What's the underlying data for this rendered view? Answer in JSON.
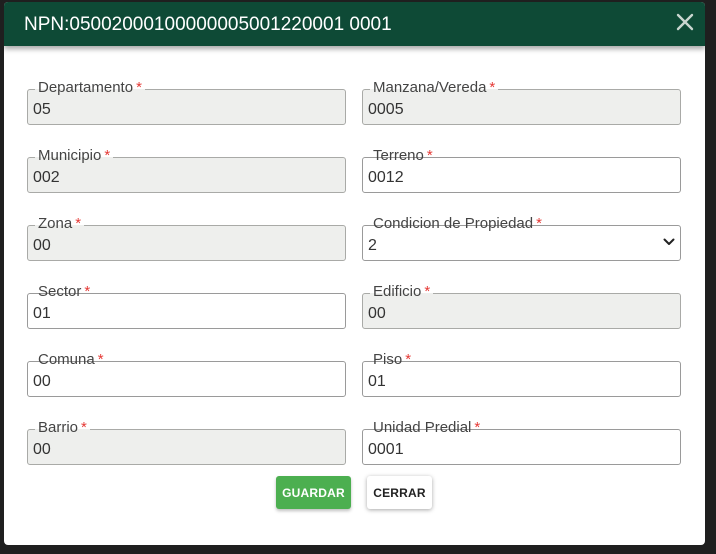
{
  "modal": {
    "title": "NPN: 05002000100000005001220001 0001",
    "close_symbol": "✕"
  },
  "fields": {
    "departamento": {
      "label": "Departamento",
      "value": "05",
      "disabled": true
    },
    "manzana": {
      "label": "Manzana/Vereda",
      "value": "0005",
      "disabled": true
    },
    "municipio": {
      "label": "Municipio",
      "value": "002",
      "disabled": true
    },
    "terreno": {
      "label": "Terreno",
      "value": "0012",
      "disabled": false
    },
    "zona": {
      "label": "Zona",
      "value": "00",
      "disabled": true
    },
    "condicion": {
      "label": "Condicion de Propiedad",
      "value": "2",
      "disabled": false
    },
    "sector": {
      "label": "Sector",
      "value": "01",
      "disabled": false
    },
    "edificio": {
      "label": "Edificio",
      "value": "00",
      "disabled": true
    },
    "comuna": {
      "label": "Comuna",
      "value": "00",
      "disabled": false
    },
    "piso": {
      "label": "Piso",
      "value": "01",
      "disabled": false
    },
    "barrio": {
      "label": "Barrio",
      "value": "00",
      "disabled": true
    },
    "unidad": {
      "label": "Unidad Predial",
      "value": "0001",
      "disabled": false
    }
  },
  "required_mark": "*",
  "buttons": {
    "save": "GUARDAR",
    "close": "CERRAR"
  },
  "colors": {
    "header": "#0e4a36",
    "save": "#4caf50",
    "required": "#e53935",
    "disabled_bg": "#eeefed"
  }
}
